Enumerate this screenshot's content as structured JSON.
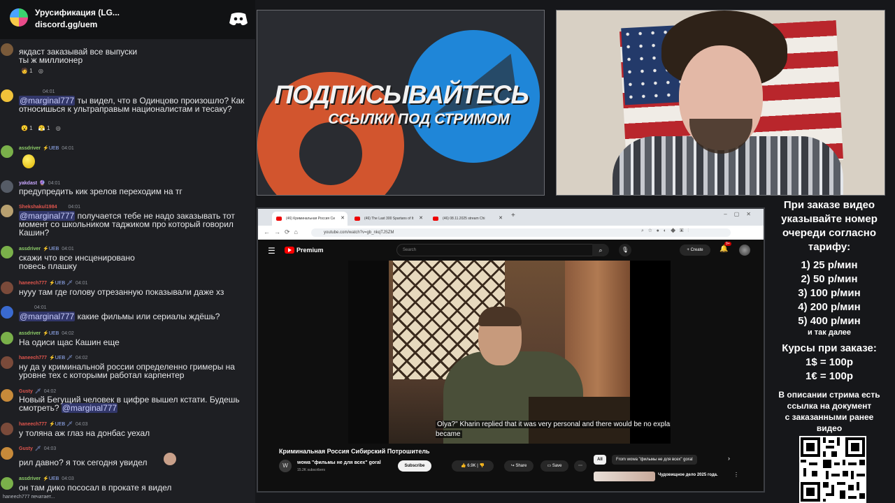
{
  "server": {
    "name": "Урусификация (LG...",
    "invite": "discord.gg/uem"
  },
  "messages": [
    {
      "user": "",
      "time": "",
      "badges": "",
      "text": "якдаст заказывай все выпуски\nты ж миллионер",
      "reactions": [
        "🧑 1",
        "◎"
      ]
    },
    {
      "user": "",
      "time": "04:01",
      "badges": "",
      "mention": "@marginal777",
      "text": " ты видел, что в Одинцово произошло? Как относишься к ультраправым националистам и тесаку?",
      "reactions": [
        "😮 1",
        "😤 1",
        "◎"
      ]
    },
    {
      "user": "assdriver",
      "time": "04:01",
      "badges": "⚡UEB",
      "text": "",
      "emoji": "😮"
    },
    {
      "user": "yakdast",
      "time": "04:01",
      "badges": "🔮",
      "text": "предупредить кик зрелов переходим на тг"
    },
    {
      "user": "Shekshakul1984",
      "time": "04:01",
      "badges": "",
      "mention": "@marginal777",
      "text": " получается тебе не надо заказывать тот момент со школьником таджиком про который говорил Кашин?"
    },
    {
      "user": "assdriver",
      "time": "04:01",
      "badges": "⚡UEB",
      "text": "скажи что все инсценировано\nповесь плашку"
    },
    {
      "user": "haneech777",
      "time": "04:01",
      "badges": "⚡UEB 🗡",
      "text": "нууу там где голову отрезанную показывали даже хз"
    },
    {
      "user": "",
      "time": "04:01",
      "badges": "",
      "mention": "@marginal777",
      "text": " какие фильмы или сериалы ждёшь?"
    },
    {
      "user": "assdriver",
      "time": "04:02",
      "badges": "⚡UEB",
      "text": "На одиси щас Кашин еще"
    },
    {
      "user": "haneech777",
      "time": "04:02",
      "badges": "⚡UEB 🗡",
      "text": "ну да у криминальной россии определенно гримеры на уровне тех с которыми работал карпентер"
    },
    {
      "user": "Gusty",
      "time": "04:02",
      "badges": "🗡",
      "text": "Новый Бегущий человек в цифре вышел кстати. Будешь смотреть? ",
      "mention_end": "@marginal777"
    },
    {
      "user": "haneech777",
      "time": "04:03",
      "badges": "⚡UEB 🗡",
      "text": "у толяна аж глаз на донбас уехал"
    },
    {
      "user": "Gusty",
      "time": "04:03",
      "badges": "🗡",
      "text": "рил давно? я ток сегодня увидел"
    },
    {
      "user": "assdriver",
      "time": "04:03",
      "badges": "⚡UEB",
      "text": "он там дико пососал в прокате я видел"
    }
  ],
  "typing": "haneech777 печатает...",
  "promo": {
    "title": "ПОДПИСЫВАЙТЕСЬ",
    "subtitle": "ССЫЛКИ ПОД СТРИМОМ"
  },
  "browser": {
    "tabs": [
      "(46) Криминальная Россия Си",
      "(46) The Last 300 Spartans of It",
      "(46) 08.11.2025 stream Chi"
    ],
    "url": "youtube.com/watch?v=gb_nkqTJSZM"
  },
  "youtube": {
    "brand": "Premium",
    "search_placeholder": "Search",
    "create": "Create",
    "notif_count": "9+",
    "caption": "Olya?\" Kharin replied that it was very personal and there would be no explanation. It became",
    "video_title": "Криминальная Россия Сибирский Потрошитель",
    "channel_initial": "W",
    "channel_name": "wowa \"фильмы не для всех\" goral",
    "subscribers": "15.2K subscribers",
    "subscribe": "Subscribe",
    "likes": "6.9K",
    "share": "Share",
    "save": "Save",
    "chip_all": "All",
    "chip_from": "From wowa \"фильмы не для всех\" goral",
    "rec_title": "Чудовищное дело 2025 года."
  },
  "info": {
    "lines": [
      "При заказе видео",
      "указывайте номер",
      "очереди согласно",
      "тарифу:"
    ],
    "tariffs": [
      "1) 25 р/мин",
      "2) 50 р/мин",
      "3) 100 р/мин",
      "4) 200 р/мин",
      "5) 400 р/мин"
    ],
    "etc": "и так далее",
    "rates_title": "Курсы при заказе:",
    "rates": [
      "1$ = 100р",
      "1€ = 100р"
    ],
    "desc": [
      "В описании стрима есть",
      "ссылка на документ",
      "с заказанными ранее",
      "видео"
    ]
  },
  "colors": {
    "mention_bg": "#5865f2",
    "youtube_red": "#ff0000",
    "boosty": "#d2552e",
    "telegram": "#1f86d8"
  }
}
